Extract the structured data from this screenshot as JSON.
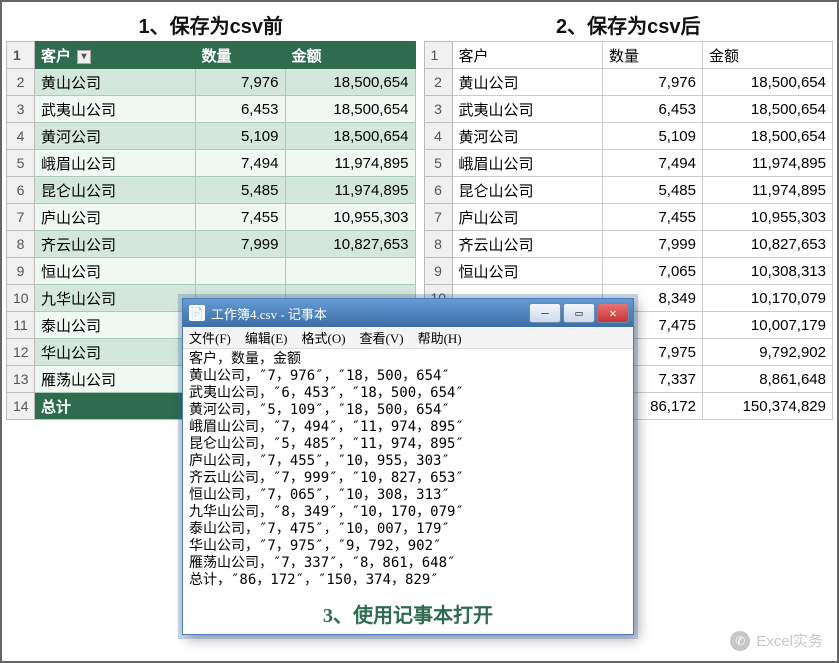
{
  "titles": {
    "left": "1、保存为csv前",
    "right": "2、保存为csv后",
    "bottom": "3、使用记事本打开"
  },
  "headers": {
    "a": "客户",
    "b": "数量",
    "c": "金额"
  },
  "rows": [
    {
      "n": "1"
    },
    {
      "n": "2",
      "a": "黄山公司",
      "b": "7,976",
      "c": "18,500,654"
    },
    {
      "n": "3",
      "a": "武夷山公司",
      "b": "6,453",
      "c": "18,500,654"
    },
    {
      "n": "4",
      "a": "黄河公司",
      "b": "5,109",
      "c": "18,500,654"
    },
    {
      "n": "5",
      "a": "峨眉山公司",
      "b": "7,494",
      "c": "11,974,895"
    },
    {
      "n": "6",
      "a": "昆仑山公司",
      "b": "5,485",
      "c": "11,974,895"
    },
    {
      "n": "7",
      "a": "庐山公司",
      "b": "7,455",
      "c": "10,955,303"
    },
    {
      "n": "8",
      "a": "齐云山公司",
      "b": "7,999",
      "c": "10,827,653"
    },
    {
      "n": "9",
      "a": "恒山公司",
      "b": "7,065",
      "c": "10,308,313"
    },
    {
      "n": "10",
      "a": "九华山公司",
      "b": "8,349",
      "c": "10,170,079"
    },
    {
      "n": "11",
      "a": "泰山公司",
      "b": "7,475",
      "c": "10,007,179"
    },
    {
      "n": "12",
      "a": "华山公司",
      "b": "7,975",
      "c": "9,792,902"
    },
    {
      "n": "13",
      "a": "雁荡山公司",
      "b": "7,337",
      "c": "8,861,648"
    },
    {
      "n": "14",
      "a": "总计",
      "b": "86,172",
      "c": "150,374,829",
      "total": true
    }
  ],
  "left_b_visible": "86",
  "notepad": {
    "title": "工作簿4.csv - 记事本",
    "menu": {
      "file": "文件(F)",
      "edit": "编辑(E)",
      "format": "格式(O)",
      "view": "查看(V)",
      "help": "帮助(H)"
    },
    "content": "客户，数量，金额\n黄山公司，″7，976″，″18，500，654″\n武夷山公司，″6，453″，″18，500，654″\n黄河公司，″5，109″，″18，500，654″\n峨眉山公司，″7，494″，″11，974，895″\n昆仑山公司，″5，485″，″11，974，895″\n庐山公司，″7，455″，″10，955，303″\n齐云山公司，″7，999″，″10，827，653″\n恒山公司，″7，065″，″10，308，313″\n九华山公司，″8，349″，″10，170，079″\n泰山公司，″7，475″，″10，007，179″\n华山公司，″7，975″，″9，792，902″\n雁荡山公司，″7，337″，″8，861，648″\n总计，″86，172″，″150，374，829″"
  },
  "watermark": "Excel实务"
}
